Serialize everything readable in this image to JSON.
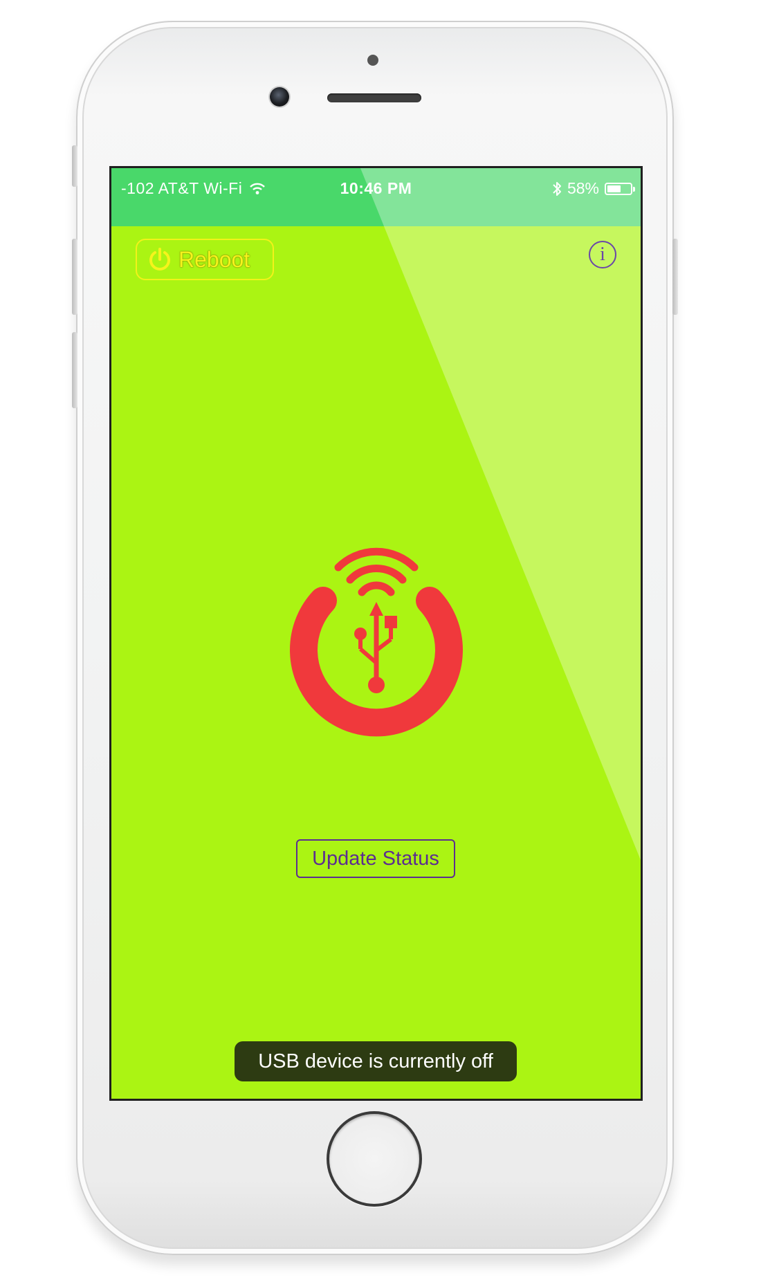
{
  "status_bar": {
    "carrier": "-102 AT&T Wi-Fi",
    "time": "10:46 PM",
    "battery": "58%",
    "battery_level": 0.58,
    "icons": [
      "wifi-icon",
      "bluetooth-icon",
      "battery-icon"
    ]
  },
  "toolbar": {
    "reboot_label": "Reboot",
    "info_label": "i"
  },
  "main": {
    "logo_icon": "usb-wifi-power-icon",
    "update_button_label": "Update Status",
    "status_message": "USB device is currently off"
  },
  "colors": {
    "background": "#abf413",
    "status_bar": "#49d86a",
    "logo": "#f0393c",
    "reboot": "#f6f31c",
    "accent": "#5c2d91",
    "toast": "#2d3b12"
  }
}
